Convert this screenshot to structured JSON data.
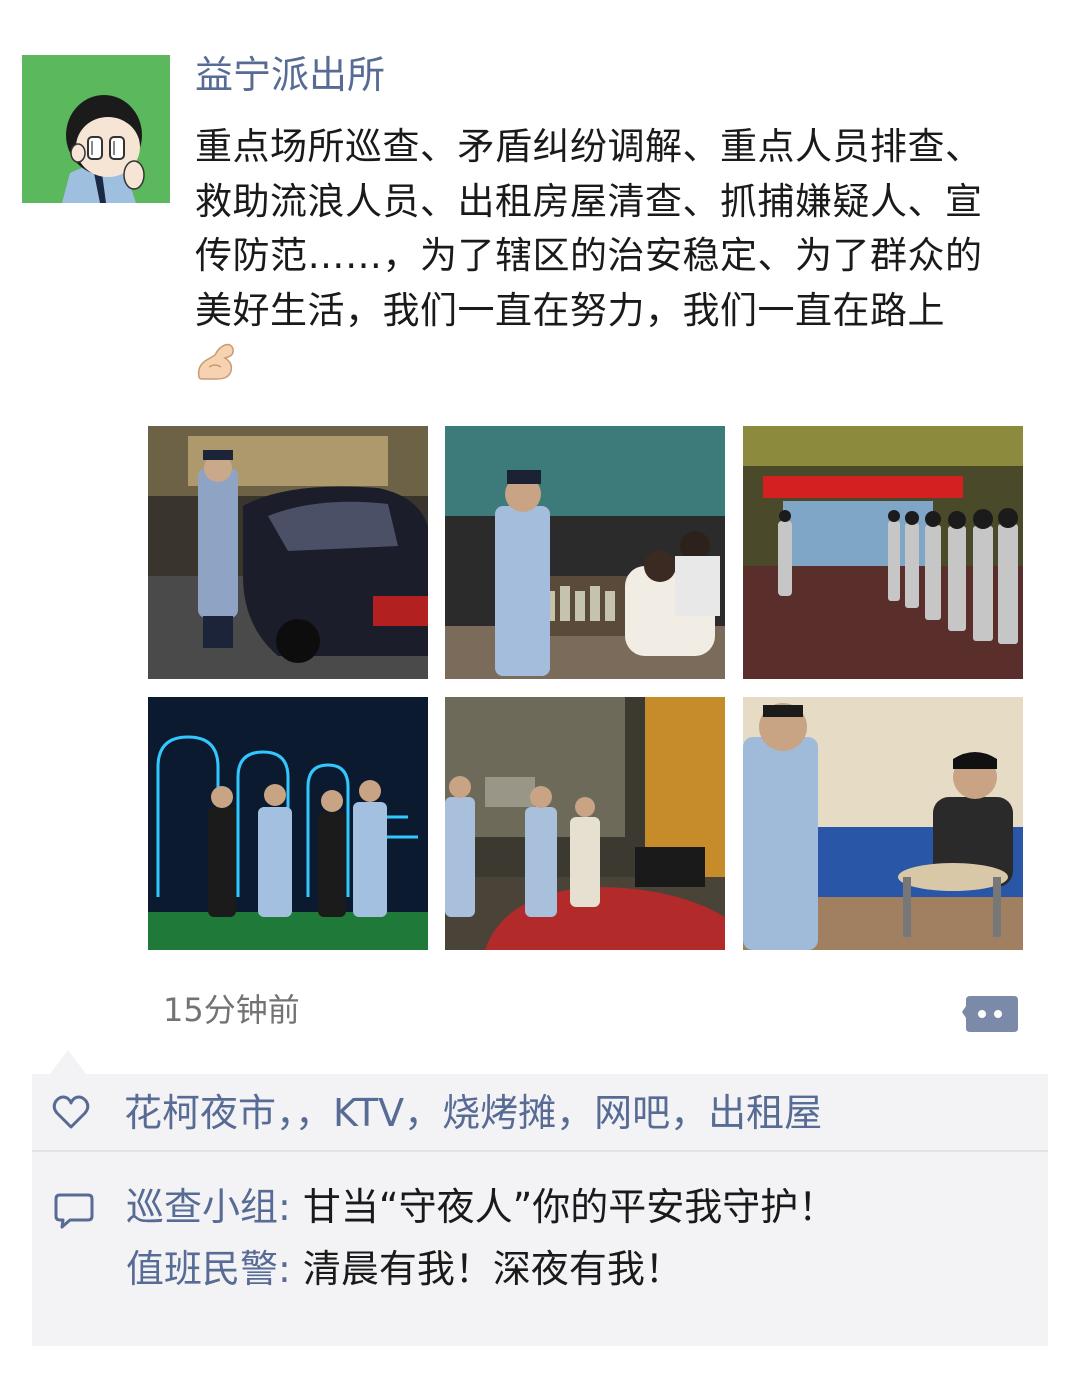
{
  "post": {
    "author": "益宁派出所",
    "text": "重点场所巡查、矛盾纠纷调解、重点人员排查、救助流浪人员、出租房屋清查、抓捕嫌疑人、宣传防范……，为了辖区的治安稳定、为了群众的美好生活，我们一直在努力，我们一直在路上",
    "text_emoji": "flexed-biceps-emoji",
    "avatar_icon": "police-cartoon-avatar",
    "photos": [
      {
        "name": "photo-patrol-car"
      },
      {
        "name": "photo-bar-inspection"
      },
      {
        "name": "photo-squad-lineup"
      },
      {
        "name": "photo-ktv-inspection"
      },
      {
        "name": "photo-street-patrol"
      },
      {
        "name": "photo-interview"
      }
    ],
    "timestamp": "15分钟前"
  },
  "likes": {
    "icon": "heart-icon",
    "text": "花柯夜市，，KTV，烧烤摊，网吧，出租屋"
  },
  "comments": [
    {
      "author": "巡查小组",
      "separator": ": ",
      "text": "甘当“守夜人”你的平安我守护！"
    },
    {
      "author": "值班民警",
      "separator": ": ",
      "text": "清晨有我！深夜有我！"
    }
  ],
  "colors": {
    "link": "#576b95",
    "avatar_bg": "#5cb85c",
    "panel_bg": "#f3f3f5",
    "timestamp": "#737373"
  }
}
